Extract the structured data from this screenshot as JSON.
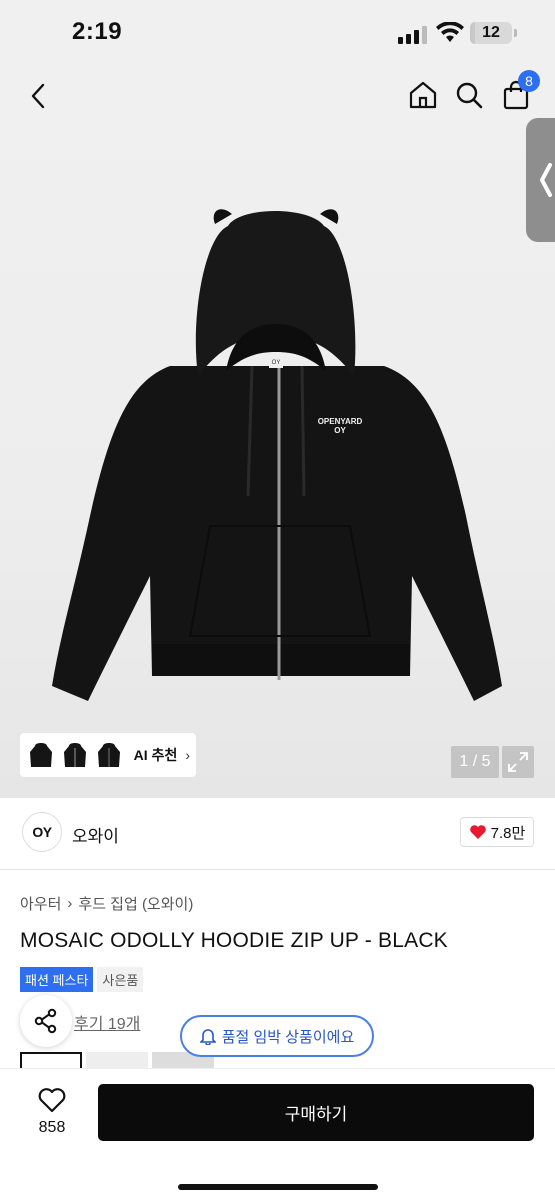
{
  "status": {
    "time": "2:19",
    "battery": "12",
    "battery_fraction": 0.12
  },
  "header": {
    "cart_count": "8"
  },
  "hero": {
    "ai_label": "AI 추천",
    "page_indicator": "1 / 5",
    "print_line1": "OPENYARD",
    "print_line2": "OY",
    "tag_text": "OY"
  },
  "brand": {
    "logo": "OY",
    "name": "오와이",
    "likes": "7.8만"
  },
  "breadcrumb": {
    "cat1": "아우터",
    "cat2": "후드 집업 (오와이)"
  },
  "product": {
    "title": "MOSAIC ODOLLY HOODIE ZIP UP - BLACK",
    "tag_festa": "패션 페스타",
    "tag_gift": "사은품",
    "reviews": "후기 19개",
    "stock_alert": "품절 임박 상품이에요"
  },
  "bottom": {
    "wish_count": "858",
    "buy_label": "구매하기"
  },
  "colors": {
    "accent": "#2e6ff2",
    "heart": "#e8192c",
    "button": "#0b0b0b"
  }
}
